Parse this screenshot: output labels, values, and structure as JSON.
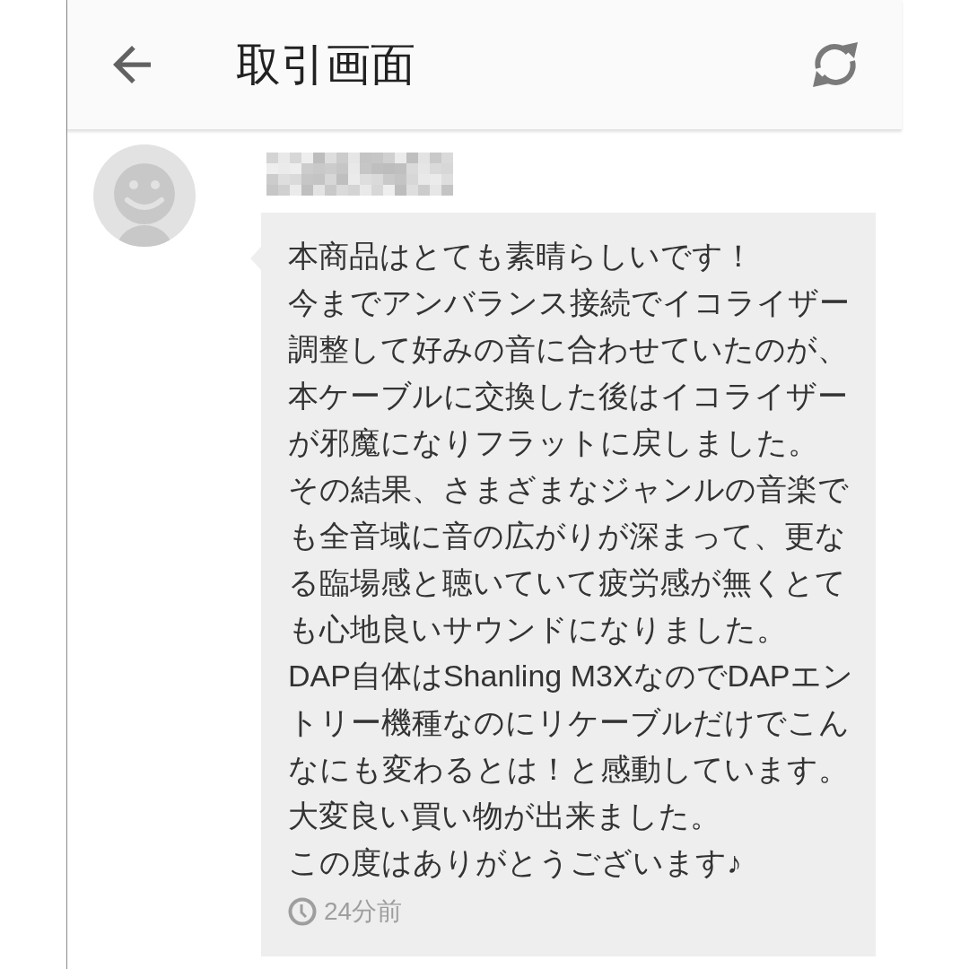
{
  "header": {
    "title": "取引画面"
  },
  "message": {
    "sender_name_redacted": true,
    "paragraphs": [
      "本商品はとても素晴らしいです！",
      "今までアンバランス接続でイコライザー調整して好みの音に合わせていたのが、本ケーブルに交換した後はイコライザーが邪魔になりフラットに戻しました。",
      "その結果、さまざまなジャンルの音楽でも全音域に音の広がりが深まって、更なる臨場感と聴いていて疲労感が無くとても心地良いサウンドになりました。",
      "DAP自体はShanling M3XなのでDAPエントリー機種なのにリケーブルだけでこんなにも変わるとは！と感動しています。",
      "大変良い買い物が出来ました。",
      "この度はありがとうございます♪"
    ],
    "time": "24分前"
  }
}
